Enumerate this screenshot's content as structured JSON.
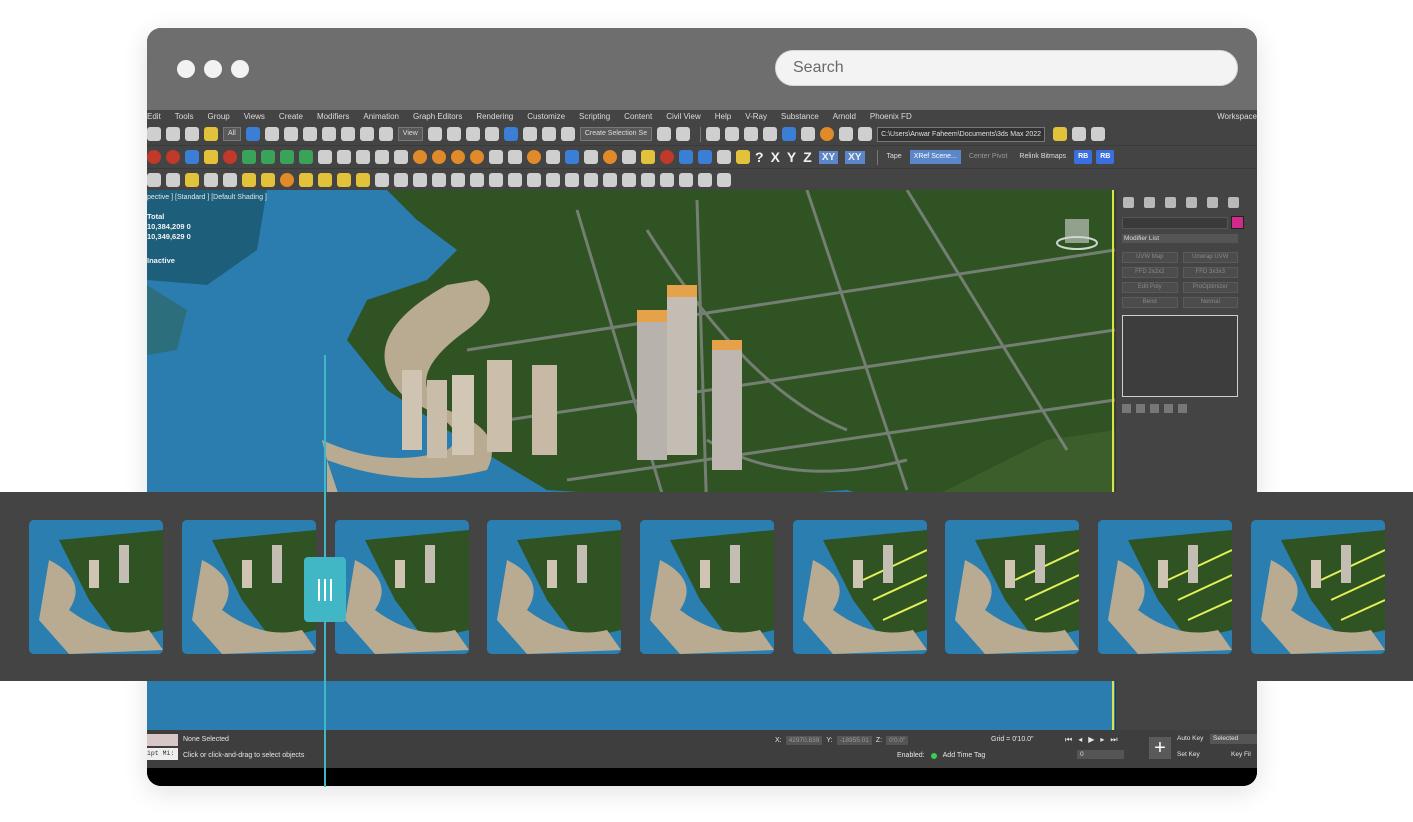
{
  "browser": {
    "search_placeholder": "Search"
  },
  "app": {
    "menu": [
      "Edit",
      "Tools",
      "Group",
      "Views",
      "Create",
      "Modifiers",
      "Animation",
      "Graph Editors",
      "Rendering",
      "Customize",
      "Scripting",
      "Content",
      "Civil View",
      "Help",
      "V-Ray",
      "Substance",
      "Arnold",
      "Phoenix FD"
    ],
    "workspace_label": "Workspace",
    "toolbar": {
      "selection_filter": "All",
      "view_dropdown": "View",
      "selection_set": "Create Selection Se",
      "project_path": "C:\\Users\\Anwar Faheem\\Documents\\3ds Max 2022",
      "axis_x": "X",
      "axis_y": "Y",
      "axis_z": "Z",
      "axis_xy": "XY",
      "axis_xy2": "XY",
      "tape": "Tape",
      "xref": "XRef Scene...",
      "center_pivot": "Center Pivot",
      "relink": "Relink Bitmaps",
      "rb1": "RB",
      "rb2": "RB"
    },
    "viewport": {
      "label": "pective ] [Standard ] [Default Shading ]",
      "stats_header": "Total",
      "stats_polys": "10,384,209  0",
      "stats_verts": "10,349,629  0",
      "inactive": "Inactive"
    },
    "command_panel": {
      "modifier_list": "Modifier List",
      "modifiers": [
        "UVW Map",
        "Unwrap UVW",
        "FFD 2x2x2",
        "FFD 3x3x3",
        "Edit Poly",
        "ProOptimizer",
        "Bend",
        "Normal"
      ],
      "swatch_color": "#d02a8b"
    },
    "status": {
      "maxscript_mini": "ipt Mi:",
      "selection": "None Selected",
      "prompt": "Click or click-and-drag to select objects",
      "x_label": "X:",
      "x_value": "42970.839",
      "y_label": "Y:",
      "y_value": "-18955.01",
      "z_label": "Z:",
      "z_value": "0'0.0\"",
      "grid": "Grid = 0'10.0\"",
      "enabled": "Enabled:",
      "add_time_tag": "Add Time Tag",
      "frame": "0",
      "auto_key": "Auto Key",
      "selected": "Selected",
      "set_key": "Set Key",
      "key_filters": "Key Fil"
    }
  },
  "filmstrip": {
    "thumbnail_count": 9
  }
}
